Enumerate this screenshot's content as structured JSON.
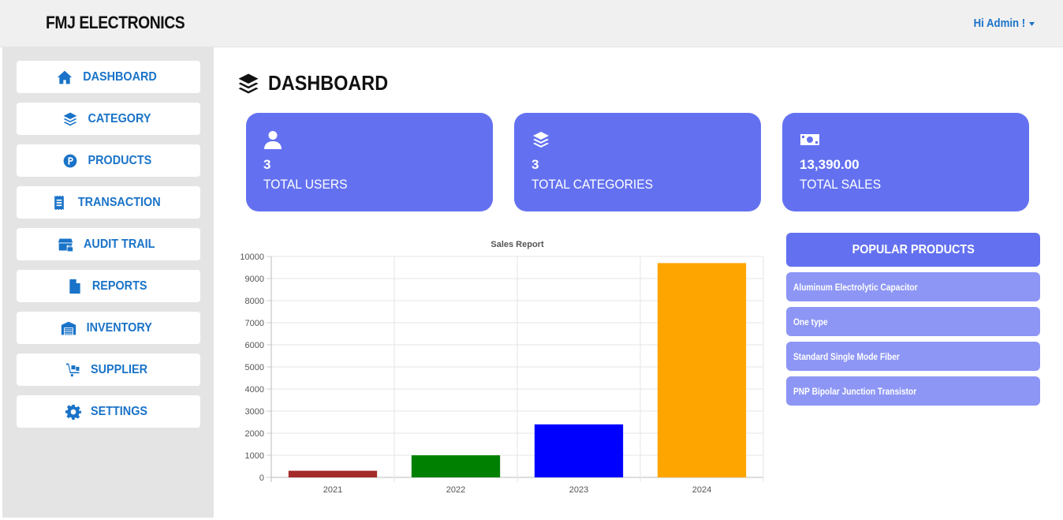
{
  "header": {
    "brand": "FMJ ELECTRONICS",
    "user_menu": "Hi Admin !"
  },
  "sidebar": {
    "items": [
      {
        "label": "DASHBOARD",
        "icon": "home-icon"
      },
      {
        "label": "CATEGORY",
        "icon": "layers-icon"
      },
      {
        "label": "PRODUCTS",
        "icon": "product-p-icon"
      },
      {
        "label": "TRANSACTION",
        "icon": "receipt-icon"
      },
      {
        "label": "AUDIT TRAIL",
        "icon": "store-lock-icon"
      },
      {
        "label": "REPORTS",
        "icon": "file-icon"
      },
      {
        "label": "INVENTORY",
        "icon": "warehouse-icon"
      },
      {
        "label": "SUPPLIER",
        "icon": "dolly-icon"
      },
      {
        "label": "SETTINGS",
        "icon": "gear-icon"
      }
    ]
  },
  "main": {
    "title": "DASHBOARD",
    "cards": [
      {
        "value": "3",
        "label": "TOTAL USERS",
        "icon": "user-icon"
      },
      {
        "value": "3",
        "label": "TOTAL CATEGORIES",
        "icon": "layers-icon"
      },
      {
        "value": "13,390.00",
        "label": "TOTAL SALES",
        "icon": "money-icon"
      }
    ],
    "popular": {
      "heading": "POPULAR PRODUCTS",
      "items": [
        "Aluminum Electrolytic Capacitor",
        "One type",
        "Standard Single Mode Fiber",
        "PNP Bipolar Junction Transistor"
      ]
    }
  },
  "colors": {
    "accent": "#1a73c8",
    "card": "#6371f0",
    "card_light": "#8d96f5"
  },
  "chart_data": {
    "type": "bar",
    "title": "Sales Report",
    "categories": [
      "2021",
      "2022",
      "2023",
      "2024"
    ],
    "values": [
      300,
      1000,
      2400,
      9700
    ],
    "bar_colors": [
      "#a52a2a",
      "#008000",
      "#0000ff",
      "#ffa500"
    ],
    "ylim": [
      0,
      10000
    ],
    "yticks": [
      0,
      1000,
      2000,
      3000,
      4000,
      5000,
      6000,
      7000,
      8000,
      9000,
      10000
    ],
    "grid": true,
    "legend": "none"
  }
}
